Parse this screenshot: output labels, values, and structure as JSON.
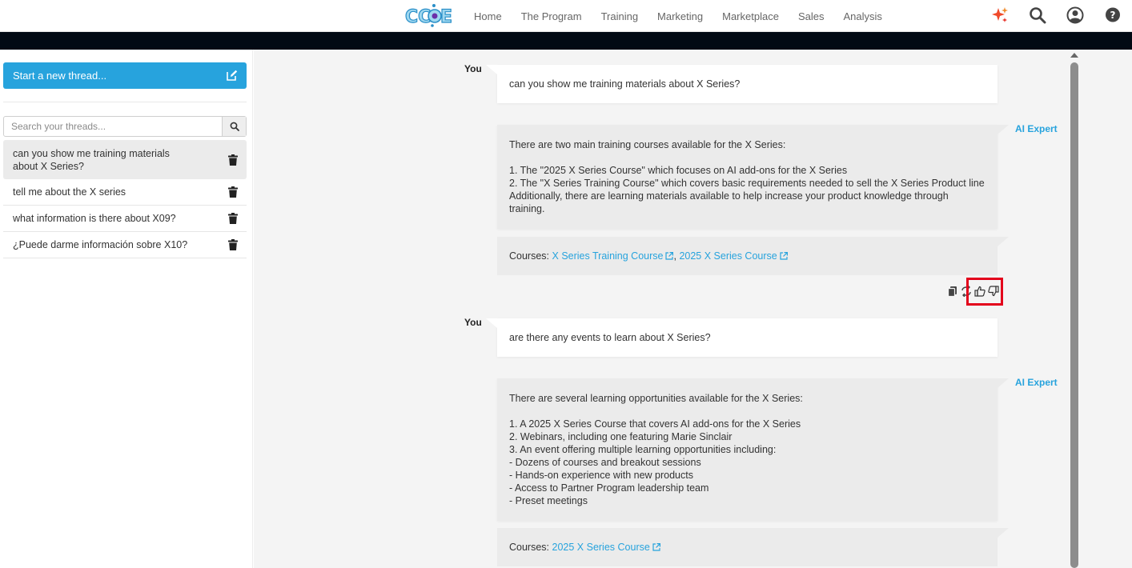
{
  "header": {
    "logo_text": "CCoE",
    "nav": [
      "Home",
      "The Program",
      "Training",
      "Marketing",
      "Marketplace",
      "Sales",
      "Analysis"
    ],
    "icons": [
      "ai-sparkle-icon",
      "search-icon",
      "user-account-icon",
      "help-icon"
    ]
  },
  "sidebar": {
    "new_thread_label": "Start a new thread...",
    "search_placeholder": "Search your threads...",
    "threads": [
      {
        "title": "can you show me training materials about X Series?",
        "active": true
      },
      {
        "title": "tell me about the X series",
        "active": false
      },
      {
        "title": "what information is there about X09?",
        "active": false
      },
      {
        "title": "¿Puede darme información sobre X10?",
        "active": false
      }
    ]
  },
  "chat": {
    "messages": [
      {
        "speaker": "You",
        "text": "can you show me training materials about X Series?"
      },
      {
        "speaker": "AI Expert",
        "lines": [
          "There are two main training courses available for the X Series:",
          "",
          "1. The \"2025 X Series Course\" which focuses on AI add-ons for the X Series",
          "2. The \"X Series Training Course\" which covers basic requirements needed to sell the X Series Product line",
          "Additionally, there are learning materials available to help increase your product knowledge through",
          "training."
        ],
        "courses_label": "Courses:",
        "courses": [
          "X Series Training Course",
          "2025 X Series Course"
        ]
      },
      {
        "speaker": "You",
        "text": "are there any events to learn about X Series?"
      },
      {
        "speaker": "AI Expert",
        "lines": [
          "There are several learning opportunities available for the X Series:",
          "",
          "1. A 2025 X Series Course that covers AI add-ons for the X Series",
          "2. Webinars, including one featuring Marie Sinclair",
          "3. An event offering multiple learning opportunities including:",
          "- Dozens of courses and breakout sessions",
          "- Hands-on experience with new products",
          "- Access to Partner Program leadership team",
          "- Preset meetings"
        ],
        "courses_label": "Courses:",
        "courses": [
          "2025 X Series Course"
        ]
      }
    ],
    "response_actions": [
      "copy-icon",
      "regenerate-icon",
      "thumbs-up-icon",
      "thumbs-down-icon"
    ],
    "course_separator": ","
  },
  "colors": {
    "accent": "#27a3dd",
    "black_bar": "#020a14",
    "highlight": "#e3001b"
  }
}
